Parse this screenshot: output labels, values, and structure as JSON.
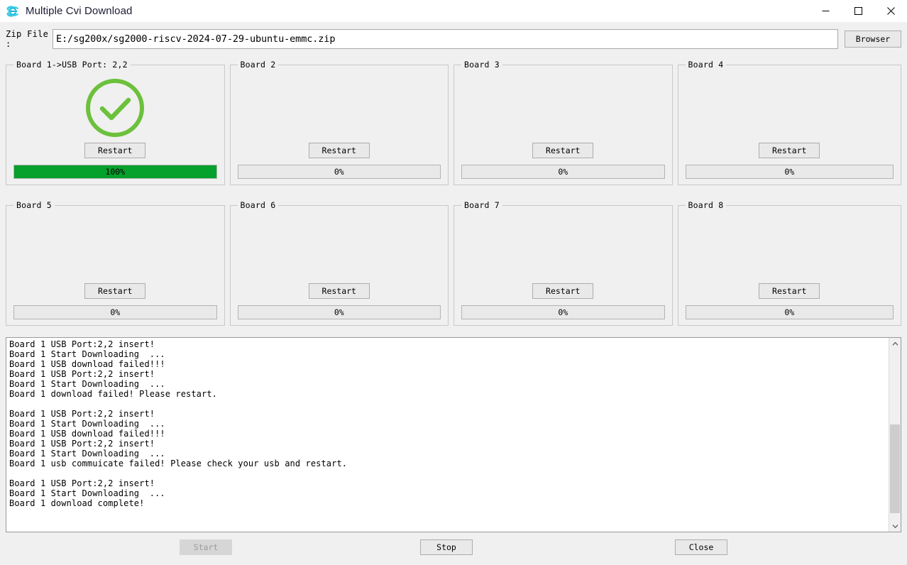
{
  "window": {
    "title": "Multiple Cvi Download",
    "icon": "cvitek-logo-icon",
    "minimize": "—",
    "maximize": "□",
    "close": "✕"
  },
  "zip_row": {
    "label": "Zip File :",
    "value": "E:/sg200x/sg2000-riscv-2024-07-29-ubuntu-emmc.zip",
    "placeholder": "",
    "browser_label": "Browser"
  },
  "boards": [
    {
      "title": "Board 1->USB Port: 2,2",
      "restart_label": "Restart",
      "progress_text": "100%",
      "progress_value": 100,
      "status_icon": "check-circle-icon"
    },
    {
      "title": "Board 2",
      "restart_label": "Restart",
      "progress_text": "0%",
      "progress_value": 0,
      "status_icon": ""
    },
    {
      "title": "Board 3",
      "restart_label": "Restart",
      "progress_text": "0%",
      "progress_value": 0,
      "status_icon": ""
    },
    {
      "title": "Board 4",
      "restart_label": "Restart",
      "progress_text": "0%",
      "progress_value": 0,
      "status_icon": ""
    },
    {
      "title": "Board 5",
      "restart_label": "Restart",
      "progress_text": "0%",
      "progress_value": 0,
      "status_icon": ""
    },
    {
      "title": "Board 6",
      "restart_label": "Restart",
      "progress_text": "0%",
      "progress_value": 0,
      "status_icon": ""
    },
    {
      "title": "Board 7",
      "restart_label": "Restart",
      "progress_text": "0%",
      "progress_value": 0,
      "status_icon": ""
    },
    {
      "title": "Board 8",
      "restart_label": "Restart",
      "progress_text": "0%",
      "progress_value": 0,
      "status_icon": ""
    }
  ],
  "log": {
    "text": "Board 1 USB Port:2,2 insert!\nBoard 1 Start Downloading  ...\nBoard 1 USB download failed!!!\nBoard 1 USB Port:2,2 insert!\nBoard 1 Start Downloading  ...\nBoard 1 download failed! Please restart.\n\nBoard 1 USB Port:2,2 insert!\nBoard 1 Start Downloading  ...\nBoard 1 USB download failed!!!\nBoard 1 USB Port:2,2 insert!\nBoard 1 Start Downloading  ...\nBoard 1 usb commuicate failed! Please check your usb and restart.\n\nBoard 1 USB Port:2,2 insert!\nBoard 1 Start Downloading  ...\nBoard 1 download complete!"
  },
  "scrollbar": {
    "up_arrow": "∧",
    "down_arrow": "∨",
    "thumb_top_pct": 44,
    "thumb_height_pct": 52
  },
  "footer": {
    "start_label": "Start",
    "stop_label": "Stop",
    "close_label": "Close"
  },
  "colors": {
    "accent_green": "#6cc13c",
    "progress_green": "#06a02c",
    "logo_cyan": "#2ec5e0",
    "window_bg": "#f0f0f0",
    "button_bg": "#e9e9e9",
    "disabled_bg": "#d6d6d6"
  }
}
